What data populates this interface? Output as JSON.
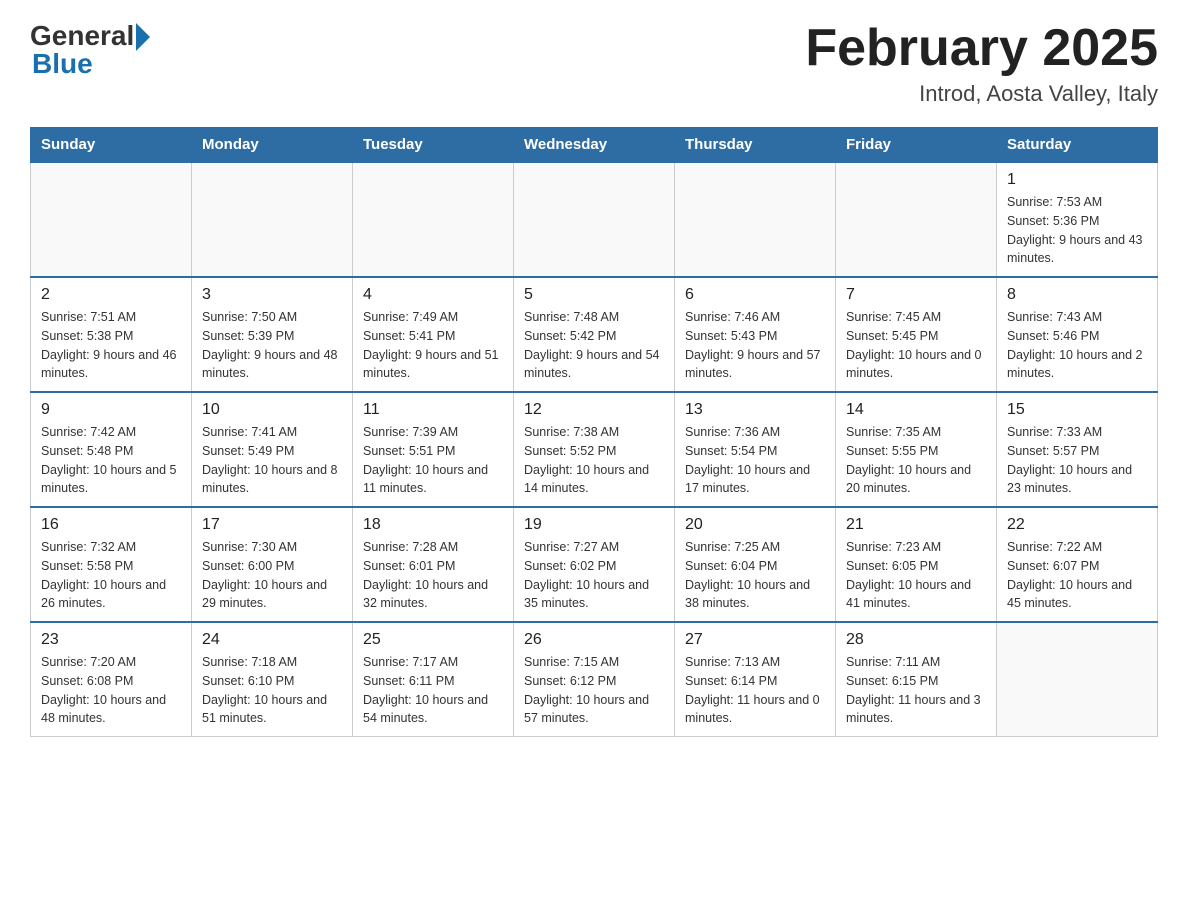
{
  "header": {
    "logo_general": "General",
    "logo_blue": "Blue",
    "title": "February 2025",
    "subtitle": "Introd, Aosta Valley, Italy"
  },
  "days_of_week": [
    "Sunday",
    "Monday",
    "Tuesday",
    "Wednesday",
    "Thursday",
    "Friday",
    "Saturday"
  ],
  "weeks": [
    [
      {
        "day": "",
        "info": ""
      },
      {
        "day": "",
        "info": ""
      },
      {
        "day": "",
        "info": ""
      },
      {
        "day": "",
        "info": ""
      },
      {
        "day": "",
        "info": ""
      },
      {
        "day": "",
        "info": ""
      },
      {
        "day": "1",
        "info": "Sunrise: 7:53 AM\nSunset: 5:36 PM\nDaylight: 9 hours and 43 minutes."
      }
    ],
    [
      {
        "day": "2",
        "info": "Sunrise: 7:51 AM\nSunset: 5:38 PM\nDaylight: 9 hours and 46 minutes."
      },
      {
        "day": "3",
        "info": "Sunrise: 7:50 AM\nSunset: 5:39 PM\nDaylight: 9 hours and 48 minutes."
      },
      {
        "day": "4",
        "info": "Sunrise: 7:49 AM\nSunset: 5:41 PM\nDaylight: 9 hours and 51 minutes."
      },
      {
        "day": "5",
        "info": "Sunrise: 7:48 AM\nSunset: 5:42 PM\nDaylight: 9 hours and 54 minutes."
      },
      {
        "day": "6",
        "info": "Sunrise: 7:46 AM\nSunset: 5:43 PM\nDaylight: 9 hours and 57 minutes."
      },
      {
        "day": "7",
        "info": "Sunrise: 7:45 AM\nSunset: 5:45 PM\nDaylight: 10 hours and 0 minutes."
      },
      {
        "day": "8",
        "info": "Sunrise: 7:43 AM\nSunset: 5:46 PM\nDaylight: 10 hours and 2 minutes."
      }
    ],
    [
      {
        "day": "9",
        "info": "Sunrise: 7:42 AM\nSunset: 5:48 PM\nDaylight: 10 hours and 5 minutes."
      },
      {
        "day": "10",
        "info": "Sunrise: 7:41 AM\nSunset: 5:49 PM\nDaylight: 10 hours and 8 minutes."
      },
      {
        "day": "11",
        "info": "Sunrise: 7:39 AM\nSunset: 5:51 PM\nDaylight: 10 hours and 11 minutes."
      },
      {
        "day": "12",
        "info": "Sunrise: 7:38 AM\nSunset: 5:52 PM\nDaylight: 10 hours and 14 minutes."
      },
      {
        "day": "13",
        "info": "Sunrise: 7:36 AM\nSunset: 5:54 PM\nDaylight: 10 hours and 17 minutes."
      },
      {
        "day": "14",
        "info": "Sunrise: 7:35 AM\nSunset: 5:55 PM\nDaylight: 10 hours and 20 minutes."
      },
      {
        "day": "15",
        "info": "Sunrise: 7:33 AM\nSunset: 5:57 PM\nDaylight: 10 hours and 23 minutes."
      }
    ],
    [
      {
        "day": "16",
        "info": "Sunrise: 7:32 AM\nSunset: 5:58 PM\nDaylight: 10 hours and 26 minutes."
      },
      {
        "day": "17",
        "info": "Sunrise: 7:30 AM\nSunset: 6:00 PM\nDaylight: 10 hours and 29 minutes."
      },
      {
        "day": "18",
        "info": "Sunrise: 7:28 AM\nSunset: 6:01 PM\nDaylight: 10 hours and 32 minutes."
      },
      {
        "day": "19",
        "info": "Sunrise: 7:27 AM\nSunset: 6:02 PM\nDaylight: 10 hours and 35 minutes."
      },
      {
        "day": "20",
        "info": "Sunrise: 7:25 AM\nSunset: 6:04 PM\nDaylight: 10 hours and 38 minutes."
      },
      {
        "day": "21",
        "info": "Sunrise: 7:23 AM\nSunset: 6:05 PM\nDaylight: 10 hours and 41 minutes."
      },
      {
        "day": "22",
        "info": "Sunrise: 7:22 AM\nSunset: 6:07 PM\nDaylight: 10 hours and 45 minutes."
      }
    ],
    [
      {
        "day": "23",
        "info": "Sunrise: 7:20 AM\nSunset: 6:08 PM\nDaylight: 10 hours and 48 minutes."
      },
      {
        "day": "24",
        "info": "Sunrise: 7:18 AM\nSunset: 6:10 PM\nDaylight: 10 hours and 51 minutes."
      },
      {
        "day": "25",
        "info": "Sunrise: 7:17 AM\nSunset: 6:11 PM\nDaylight: 10 hours and 54 minutes."
      },
      {
        "day": "26",
        "info": "Sunrise: 7:15 AM\nSunset: 6:12 PM\nDaylight: 10 hours and 57 minutes."
      },
      {
        "day": "27",
        "info": "Sunrise: 7:13 AM\nSunset: 6:14 PM\nDaylight: 11 hours and 0 minutes."
      },
      {
        "day": "28",
        "info": "Sunrise: 7:11 AM\nSunset: 6:15 PM\nDaylight: 11 hours and 3 minutes."
      },
      {
        "day": "",
        "info": ""
      }
    ]
  ]
}
